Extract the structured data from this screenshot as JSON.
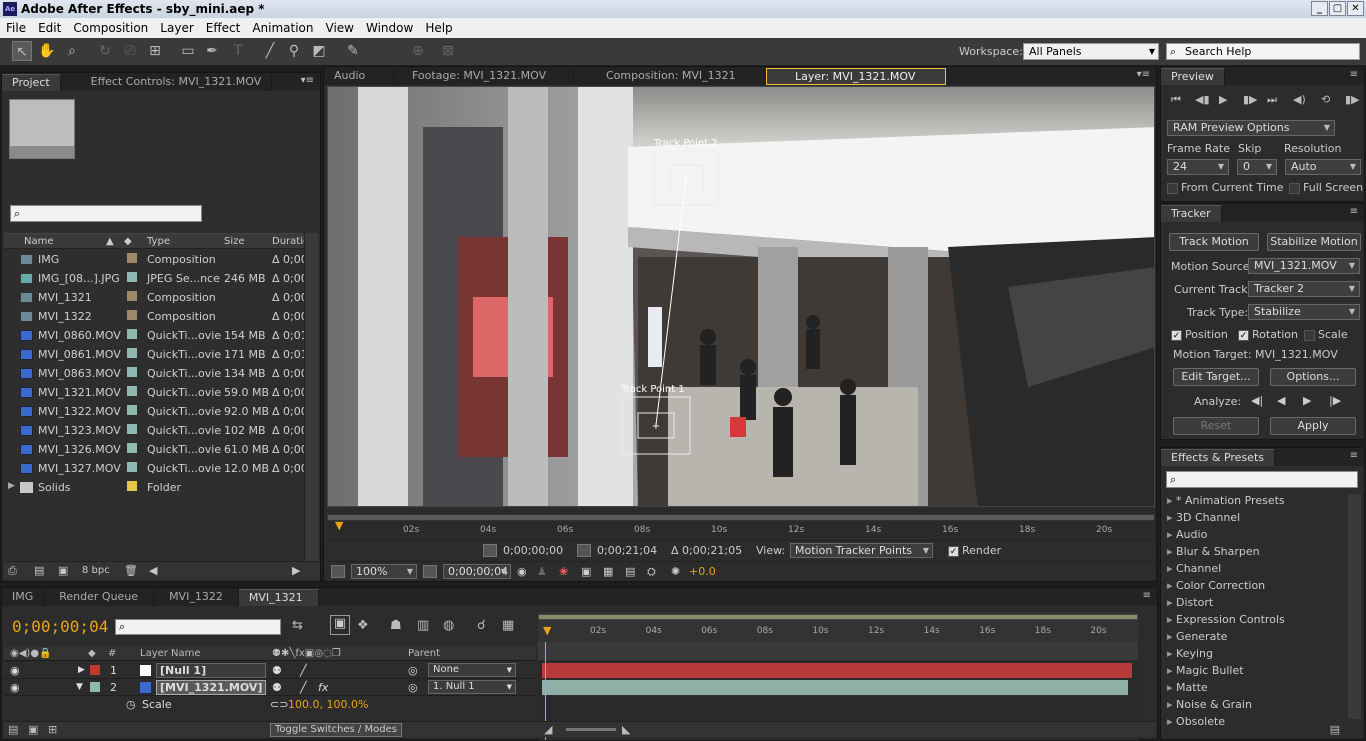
{
  "window": {
    "title": "Adobe After Effects - sby_mini.aep *",
    "app_icon": "Ae",
    "min": "_",
    "max": "▢",
    "close": "✕"
  },
  "menu": [
    "File",
    "Edit",
    "Composition",
    "Layer",
    "Effect",
    "Animation",
    "View",
    "Window",
    "Help"
  ],
  "toolbar": {
    "workspace_label": "Workspace:",
    "workspace_value": "All Panels",
    "search_placeholder": "Search Help"
  },
  "project": {
    "tabs": [
      "Project",
      "Effect Controls: MVI_1321.MOV"
    ],
    "columns": [
      "Name",
      "Type",
      "Size",
      "Duration"
    ],
    "items": [
      {
        "name": "IMG",
        "type": "Composition",
        "size": "",
        "duration": "Δ 0;00",
        "icon": "comp",
        "label_color": "#9c8a6a"
      },
      {
        "name": "IMG_[08...].JPG",
        "type": "JPEG Se...nce",
        "size": "246 MB",
        "duration": "Δ 0;00",
        "icon": "jpeg",
        "label_color": "#8fb8b0"
      },
      {
        "name": "MVI_1321",
        "type": "Composition",
        "size": "",
        "duration": "Δ 0;00",
        "icon": "comp",
        "label_color": "#9c8a6a"
      },
      {
        "name": "MVI_1322",
        "type": "Composition",
        "size": "",
        "duration": "Δ 0;00",
        "icon": "comp",
        "label_color": "#9c8a6a"
      },
      {
        "name": "MVI_0860.MOV",
        "type": "QuickTi...ovie",
        "size": "154 MB",
        "duration": "Δ 0;01",
        "icon": "mov",
        "label_color": "#8fb8b0"
      },
      {
        "name": "MVI_0861.MOV",
        "type": "QuickTi...ovie",
        "size": "171 MB",
        "duration": "Δ 0;01",
        "icon": "mov",
        "label_color": "#8fb8b0"
      },
      {
        "name": "MVI_0863.MOV",
        "type": "QuickTi...ovie",
        "size": "134 MB",
        "duration": "Δ 0;00",
        "icon": "mov",
        "label_color": "#8fb8b0"
      },
      {
        "name": "MVI_1321.MOV",
        "type": "QuickTi...ovie",
        "size": "59.0 MB",
        "duration": "Δ 0;00",
        "icon": "mov",
        "label_color": "#8fb8b0"
      },
      {
        "name": "MVI_1322.MOV",
        "type": "QuickTi...ovie",
        "size": "92.0 MB",
        "duration": "Δ 0;00",
        "icon": "mov",
        "label_color": "#8fb8b0"
      },
      {
        "name": "MVI_1323.MOV",
        "type": "QuickTi...ovie",
        "size": "102 MB",
        "duration": "Δ 0;00",
        "icon": "mov",
        "label_color": "#8fb8b0"
      },
      {
        "name": "MVI_1326.MOV",
        "type": "QuickTi...ovie",
        "size": "61.0 MB",
        "duration": "Δ 0;00",
        "icon": "mov",
        "label_color": "#8fb8b0"
      },
      {
        "name": "MVI_1327.MOV",
        "type": "QuickTi...ovie",
        "size": "12.0 MB",
        "duration": "Δ 0;00",
        "icon": "mov",
        "label_color": "#8fb8b0"
      },
      {
        "name": "Solids",
        "type": "Folder",
        "size": "",
        "duration": "",
        "icon": "fold",
        "label_color": "#e6c84a"
      }
    ],
    "bpc": "8 bpc"
  },
  "viewer": {
    "tabs": [
      "Audio",
      "Footage: MVI_1321.MOV",
      "Composition: MVI_1321",
      "Layer: MVI_1321.MOV"
    ],
    "track_points": [
      "Track Point 2",
      "Track Point 1"
    ],
    "ruler_ticks": [
      "02s",
      "04s",
      "06s",
      "08s",
      "10s",
      "12s",
      "14s",
      "16s",
      "18s",
      "20s"
    ],
    "in_time": "0;00;00;00",
    "out_time": "0;00;21;04",
    "duration": "Δ 0;00;21;05",
    "view_label": "View:",
    "view_value": "Motion Tracker Points",
    "render_label": "Render",
    "zoom": "100%",
    "current_time": "0;00;00;04",
    "exposure": "+0.0"
  },
  "preview": {
    "tab": "Preview",
    "ram_options": "RAM Preview Options",
    "frame_rate_label": "Frame Rate",
    "skip_label": "Skip",
    "resolution_label": "Resolution",
    "frame_rate": "24",
    "skip": "0",
    "resolution": "Auto",
    "from_current_time": "From Current Time",
    "full_screen": "Full Screen"
  },
  "tracker": {
    "tab": "Tracker",
    "track_motion": "Track Motion",
    "stabilize_motion": "Stabilize Motion",
    "motion_source_label": "Motion Source:",
    "motion_source": "MVI_1321.MOV",
    "current_track_label": "Current Track:",
    "current_track": "Tracker 2",
    "track_type_label": "Track Type:",
    "track_type": "Stabilize",
    "position": "Position",
    "rotation": "Rotation",
    "scale": "Scale",
    "motion_target": "Motion Target: MVI_1321.MOV",
    "edit_target": "Edit Target...",
    "options": "Options...",
    "analyze_label": "Analyze:",
    "reset": "Reset",
    "apply": "Apply"
  },
  "effects": {
    "tab": "Effects & Presets",
    "items": [
      "* Animation Presets",
      "3D Channel",
      "Audio",
      "Blur & Sharpen",
      "Channel",
      "Color Correction",
      "Distort",
      "Expression Controls",
      "Generate",
      "Keying",
      "Magic Bullet",
      "Matte",
      "Noise & Grain",
      "Obsolete"
    ]
  },
  "timeline": {
    "tabs": [
      "IMG",
      "Render Queue",
      "MVI_1322",
      "MVI_1321"
    ],
    "timecode": "0;00;00;04",
    "columns": {
      "num": "#",
      "layer_name": "Layer Name",
      "parent": "Parent"
    },
    "layers": [
      {
        "num": "1",
        "name": "[Null 1]",
        "parent": "None",
        "label_color": "#c0392b"
      },
      {
        "num": "2",
        "name": "[MVI_1321.MOV]",
        "parent": "1. Null 1",
        "label_color": "#8fb8b0"
      }
    ],
    "scale_label": "Scale",
    "scale_value": "100.0, 100.0%",
    "ruler_ticks": [
      "02s",
      "04s",
      "06s",
      "08s",
      "10s",
      "12s",
      "14s",
      "16s",
      "18s",
      "20s"
    ],
    "toggle_label": "Toggle Switches / Modes"
  }
}
